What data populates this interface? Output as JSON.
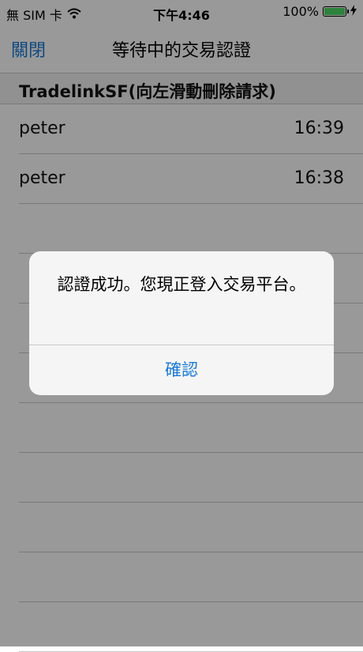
{
  "status_bar": {
    "carrier": "無 SIM 卡",
    "time": "下午4:46",
    "battery_percent": "100%",
    "battery_level": 1.0,
    "accent_battery": "#4cd964"
  },
  "nav": {
    "close_label": "關閉",
    "title": "等待中的交易認證"
  },
  "section": {
    "header": "TradelinkSF(向左滑動刪除請求)"
  },
  "requests": [
    {
      "name": "peter",
      "time": "16:39"
    },
    {
      "name": "peter",
      "time": "16:38"
    }
  ],
  "alert": {
    "message": "認證成功。您現正登入交易平台。",
    "button_label": "確認"
  },
  "colors": {
    "link_blue": "#1a7ad6"
  }
}
